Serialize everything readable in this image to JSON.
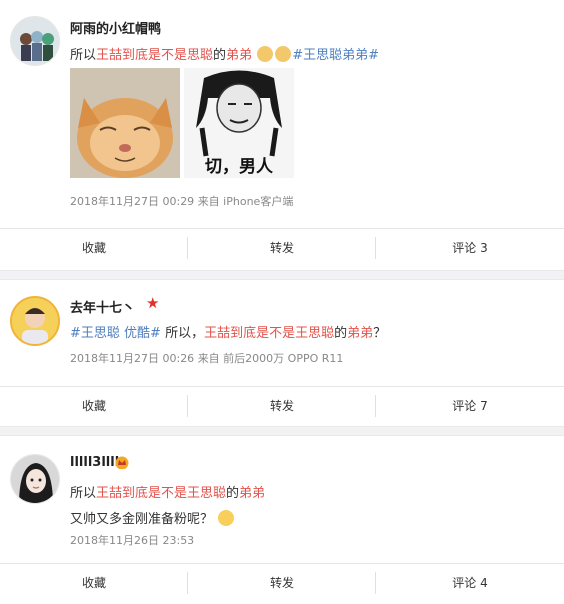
{
  "posts": [
    {
      "username": "阿雨的小红帽鸭",
      "text_prefix": "所以",
      "text_red": "王喆到底是不是思聪",
      "text_mid": "的",
      "text_red2": "弟弟",
      "hashtag": "#王思聪弟弟#",
      "image2_caption": "切，男人",
      "date": "2018年11月27日 00:29",
      "source": "来自 iPhone客户端",
      "actions": [
        "收藏",
        "转发",
        "评论 3"
      ]
    },
    {
      "username": "去年十七丶",
      "tag1": "#王思聪",
      "tag2": "优酷#",
      "text_mid": " 所以，",
      "text_red": "王喆到底是不是王思聪",
      "text_mid2": "的",
      "text_red2": "弟弟",
      "text_end": "？",
      "date": "2018年11月27日 00:26",
      "source": "来自 前后2000万 OPPO R11",
      "actions": [
        "收藏",
        "转发",
        "评论 7"
      ]
    },
    {
      "username": "lllll3llll",
      "text_prefix": "所以",
      "text_red": "王喆到底是不是王思聪",
      "text_mid": "的",
      "text_red2": "弟弟",
      "line2": "又帅又多金刚准备粉呢？",
      "date": "2018年11月26日 23:53",
      "actions": [
        "收藏",
        "转发",
        "评论 4"
      ]
    }
  ],
  "colors": {
    "accent_red": "#e2534b",
    "link_blue": "#4f7fbf",
    "separator": "#f2f2f5"
  }
}
